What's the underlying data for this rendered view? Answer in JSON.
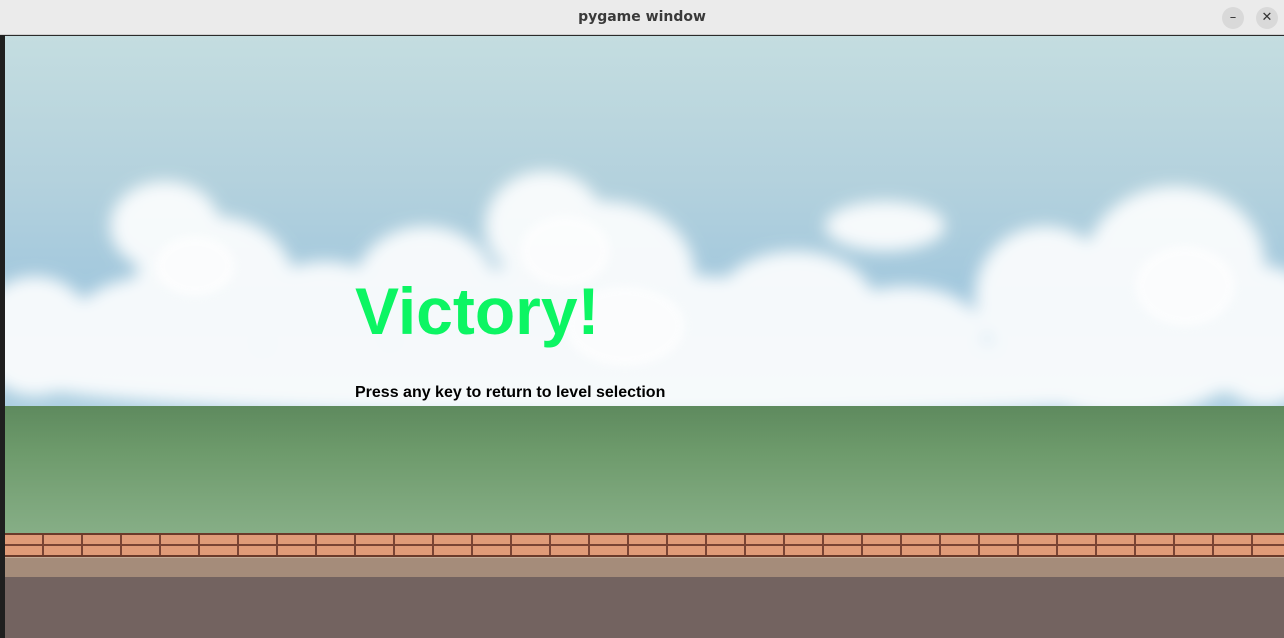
{
  "window": {
    "title": "pygame window",
    "minimize_icon": "minimize-icon",
    "close_icon": "close-icon"
  },
  "game": {
    "headline": "Victory!",
    "instruction": "Press any key to return to level selection",
    "colors": {
      "headline": "#0cf563",
      "instruction": "#000000",
      "sky": "#a9cde0",
      "grass": "#6d9a6b",
      "brick": "#e09b78",
      "ground": "#736360"
    }
  }
}
